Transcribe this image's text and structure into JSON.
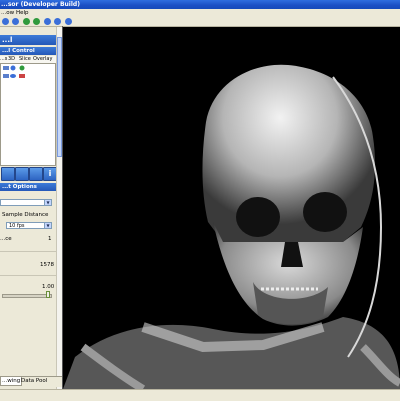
{
  "window": {
    "title": "...sor (Developer Build)"
  },
  "menu": {
    "items": [
      "...ow",
      "Help"
    ]
  },
  "toolbar": {
    "icons": [
      {
        "name": "undo-icon",
        "color": "#3a6ed8"
      },
      {
        "name": "redo-icon",
        "color": "#3a6ed8"
      },
      {
        "name": "refresh-icon",
        "color": "#2f9a3c"
      },
      {
        "name": "save-icon",
        "color": "#2f9a3c"
      },
      {
        "name": "center-icon",
        "color": "#3a6ed8"
      },
      {
        "name": "camera-icon",
        "color": "#3a6ed8"
      },
      {
        "name": "zoom-icon",
        "color": "#3a6ed8"
      }
    ]
  },
  "sidebar": {
    "header_top": "...l",
    "layer_panel": {
      "title": "...l Control",
      "columns": [
        "...s",
        "3D",
        "Slice",
        "Overlay"
      ]
    },
    "action_buttons": [
      "",
      "",
      "",
      "i"
    ],
    "render_panel": {
      "title": "...t Options",
      "sample_distance_label": "Sample Distance",
      "sample_distance_value": "10 fps",
      "row_value_1": "1",
      "row_value_label": "...ce",
      "value_2": "1578",
      "value_3": "1.00"
    },
    "tabs": {
      "viewing": "...wing",
      "data_pool": "Data Pool"
    }
  }
}
